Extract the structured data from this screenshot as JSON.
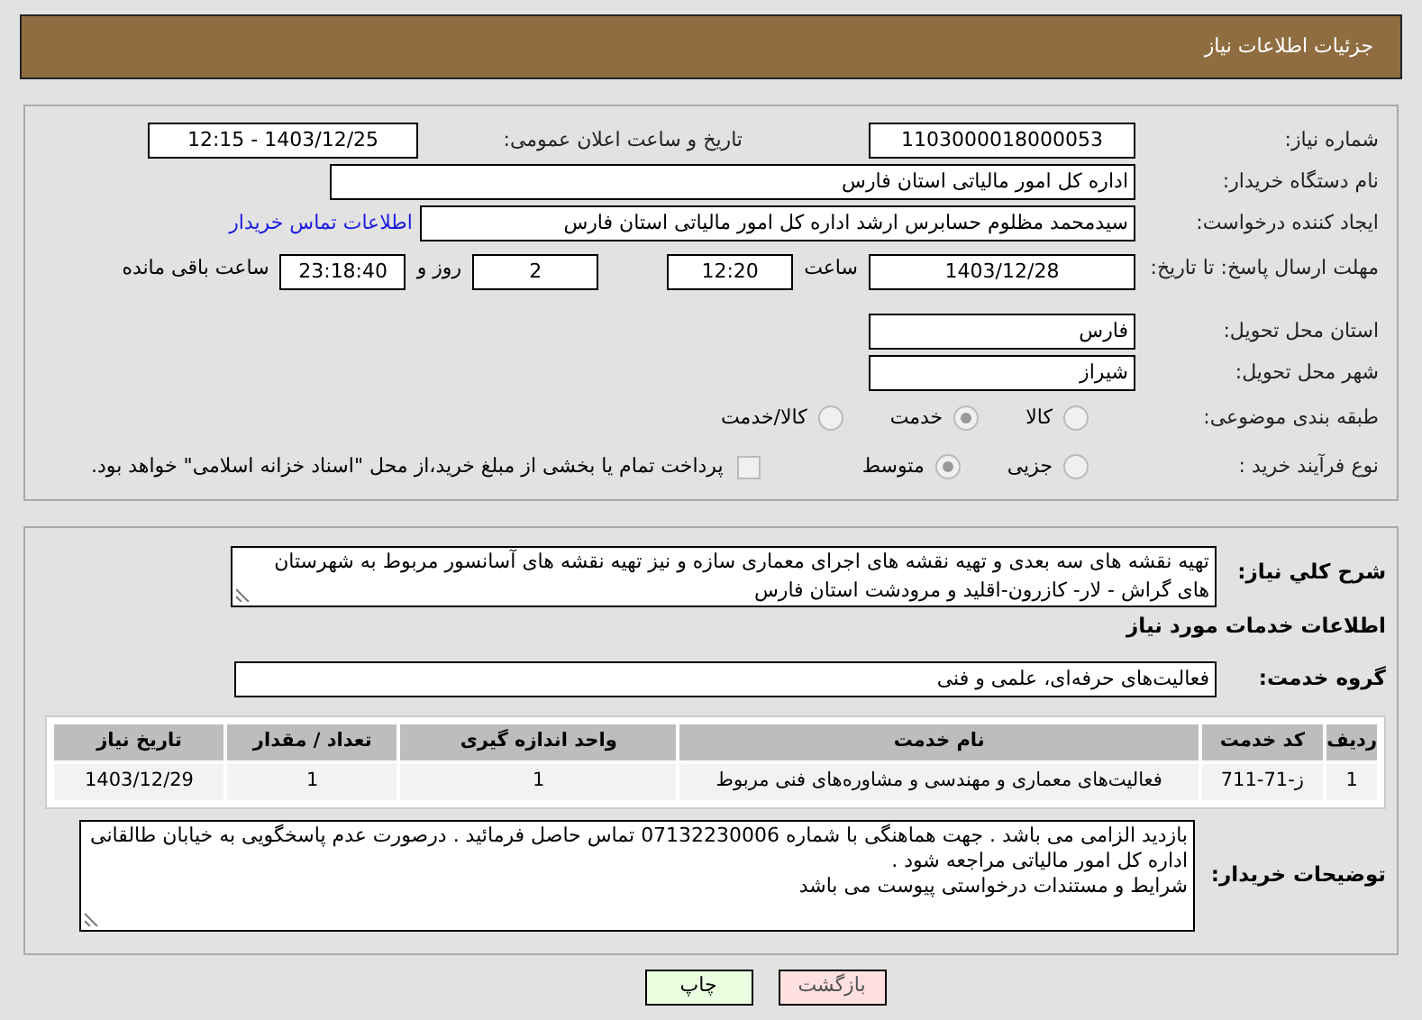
{
  "header": {
    "title": "جزئیات اطلاعات نیاز"
  },
  "need_number": {
    "label": "شماره نیاز:",
    "value": "1103000018000053"
  },
  "announce_datetime": {
    "label": "تاریخ و ساعت اعلان عمومی:",
    "value": "1403/12/25 - 12:15"
  },
  "buyer_org": {
    "label": "نام دستگاه خریدار:",
    "value": "اداره کل امور مالیاتی استان فارس"
  },
  "requester": {
    "label": "ایجاد کننده درخواست:",
    "value": "سیدمحمد مظلوم حسابرس ارشد اداره کل امور مالیاتی استان فارس",
    "link": "اطلاعات تماس خریدار"
  },
  "deadline": {
    "label": "مهلت ارسال پاسخ: تا تاریخ:",
    "date": "1403/12/28",
    "time_label": "ساعت",
    "time": "12:20",
    "days": "2",
    "days_label": "روز و",
    "remaining": "23:18:40",
    "remaining_label": "ساعت باقی مانده"
  },
  "delivery_province": {
    "label": "استان محل تحویل:",
    "value": "فارس"
  },
  "delivery_city": {
    "label": "شهر محل تحویل:",
    "value": "شیراز"
  },
  "category": {
    "label": "طبقه بندی موضوعی:",
    "options": [
      {
        "label": "کالا",
        "selected": false
      },
      {
        "label": "خدمت",
        "selected": true
      },
      {
        "label": "کالا/خدمت",
        "selected": false
      }
    ]
  },
  "purchase_process": {
    "label": "نوع فرآیند خرید :",
    "options": [
      {
        "label": "جزیی",
        "selected": false
      },
      {
        "label": "متوسط",
        "selected": true
      }
    ],
    "payment_note": {
      "checked": false,
      "text": "پرداخت تمام یا بخشی از مبلغ خرید،از محل \"اسناد خزانه اسلامی\" خواهد بود."
    }
  },
  "description": {
    "label": "شرح کلي نياز:",
    "value": "تهیه نقشه های سه بعدی و تهیه نقشه های اجرای معماری سازه و نیز تهیه نقشه های آسانسور مربوط به شهرستان های گراش - لار- کازرون-اقلید و مرودشت استان فارس"
  },
  "services_heading": "اطلاعات خدمات مورد نياز",
  "service_group": {
    "label": "گروه خدمت:",
    "value": "فعالیت‌های حرفه‌ای، علمی و فنی"
  },
  "table": {
    "columns": [
      "ردیف",
      "کد خدمت",
      "نام خدمت",
      "واحد اندازه گیری",
      "تعداد / مقدار",
      "تاریخ نیاز"
    ],
    "rows": [
      [
        "1",
        "ز-71-711",
        "فعالیت‌های معماری و مهندسی و مشاوره‌های فنی مربوط",
        "1",
        "1",
        "1403/12/29"
      ]
    ]
  },
  "buyer_notes": {
    "label": "توضیحات خریدار:",
    "lines": [
      "بازدید الزامی می باشد . جهت هماهنگی با شماره 07132230006 تماس حاصل فرمائید . درصورت عدم پاسخگویی به خیابان طالقانی اداره کل امور مالیاتی مراجعه شود .",
      "شرایط و مستندات درخواستی پیوست می باشد"
    ]
  },
  "buttons": [
    {
      "kind": "back",
      "label": "بازگشت"
    },
    {
      "kind": "print",
      "label": "چاپ"
    }
  ]
}
